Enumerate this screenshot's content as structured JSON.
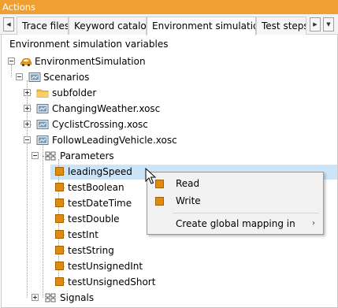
{
  "window": {
    "title": "Actions"
  },
  "tabs": {
    "scroll_left": "◀",
    "scroll_right": "▶",
    "overflow": "▼",
    "items": [
      {
        "label": "Trace files"
      },
      {
        "label": "Keyword catalog"
      },
      {
        "label": "Environment simulation",
        "active": true
      },
      {
        "label": "Test steps"
      }
    ]
  },
  "panel": {
    "title": "Environment simulation variables"
  },
  "tree": {
    "root": {
      "label": "EnvironmentSimulation",
      "icon": "car-icon"
    },
    "scenarios": {
      "label": "Scenarios",
      "icon": "scenario-folder-icon"
    },
    "subfolder": {
      "label": "subfolder",
      "icon": "folder-icon"
    },
    "files": [
      {
        "label": "ChangingWeather.xosc",
        "icon": "scenario-file-icon"
      },
      {
        "label": "CyclistCrossing.xosc",
        "icon": "scenario-file-icon"
      },
      {
        "label": "FollowLeadingVehicle.xosc",
        "icon": "scenario-file-icon"
      }
    ],
    "parameters": {
      "label": "Parameters",
      "icon": "parameters-icon"
    },
    "params": [
      {
        "label": "leadingSpeed",
        "selected": true
      },
      {
        "label": "testBoolean"
      },
      {
        "label": "testDateTime"
      },
      {
        "label": "testDouble"
      },
      {
        "label": "testInt"
      },
      {
        "label": "testString"
      },
      {
        "label": "testUnsignedInt"
      },
      {
        "label": "testUnsignedShort"
      }
    ],
    "signals": {
      "label": "Signals",
      "icon": "signals-icon"
    }
  },
  "context_menu": {
    "items": [
      {
        "label": "Read",
        "icon": "parameter-icon"
      },
      {
        "label": "Write",
        "icon": "parameter-icon"
      },
      {
        "label": "Create global mapping in",
        "submenu_arrow": "›"
      }
    ]
  },
  "colors": {
    "titlebar": "#f0a030",
    "selection": "#cce4f7",
    "parameter": "#e08a10"
  }
}
